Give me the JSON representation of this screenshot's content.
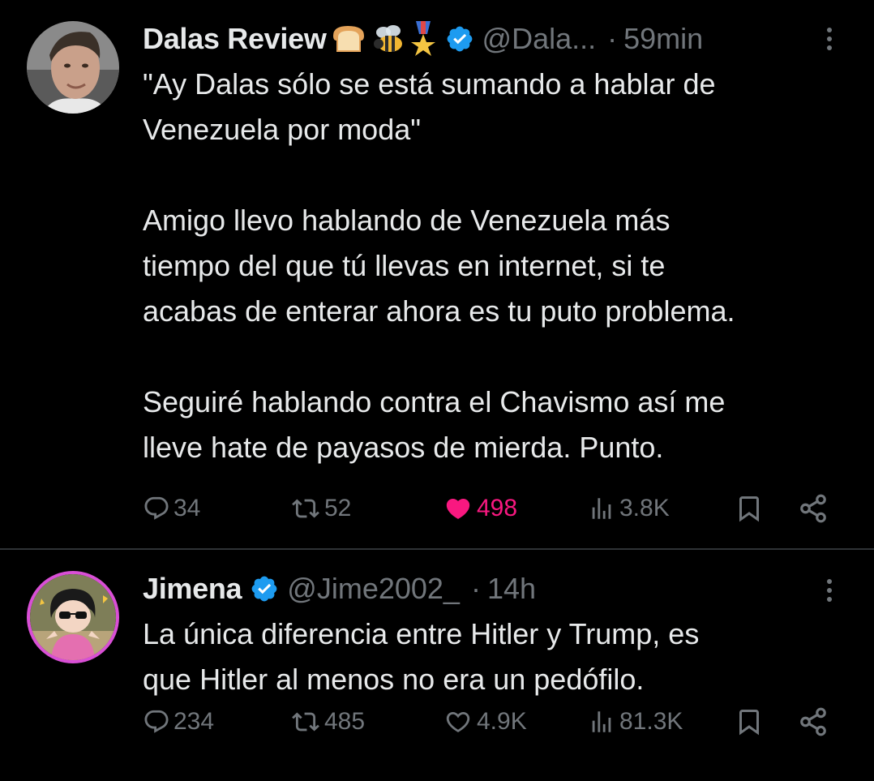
{
  "tweets": [
    {
      "name": "Dalas Review",
      "emojis": [
        "bread",
        "bee",
        "medal"
      ],
      "handle": "@Dala...",
      "separator": "·",
      "time": "59min",
      "paragraphs": [
        [
          "\"Ay Dalas sólo se está sumando a hablar de",
          "Venezuela por moda\""
        ],
        [
          "Amigo llevo hablando de Venezuela más",
          "tiempo del que tú llevas en internet, si te",
          "acabas de enterar ahora es tu puto problema."
        ],
        [
          "Seguiré hablando contra el Chavismo así me",
          "lleve hate de payasos de mierda. Punto."
        ]
      ],
      "replies": "34",
      "retweets": "52",
      "likes": "498",
      "liked": true,
      "views": "3.8K"
    },
    {
      "name": "Jimena",
      "handle": "@Jime2002_",
      "separator": "·",
      "time": "14h",
      "paragraphs": [
        [
          "La única diferencia entre Hitler y Trump, es",
          "que Hitler al menos no era un pedófilo."
        ]
      ],
      "replies": "234",
      "retweets": "485",
      "likes": "4.9K",
      "liked": false,
      "views": "81.3K"
    }
  ],
  "colors": {
    "background": "#000000",
    "text": "#e7e9ea",
    "muted": "#71767b",
    "verified": "#1d9bf0",
    "like": "#f91880",
    "divider": "#2f3336"
  }
}
